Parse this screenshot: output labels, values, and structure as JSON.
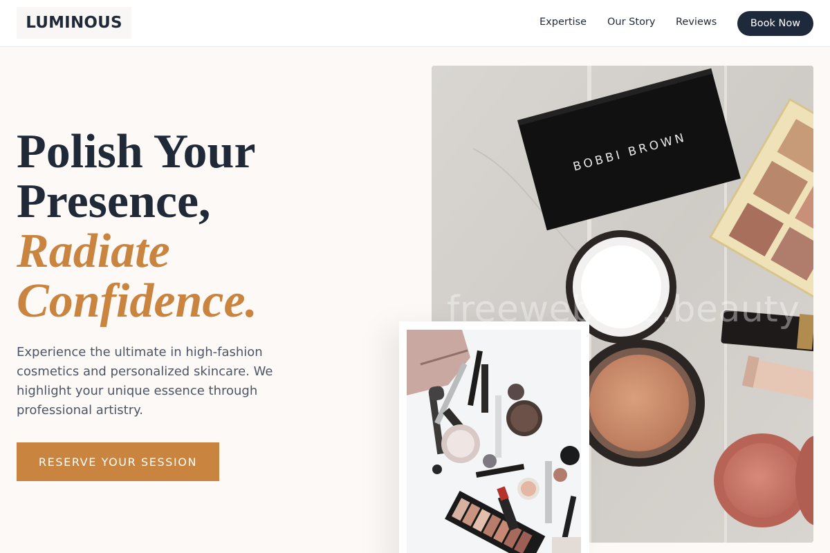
{
  "header": {
    "logo": "LUMINOUS",
    "nav": [
      {
        "label": "Expertise"
      },
      {
        "label": "Our Story"
      },
      {
        "label": "Reviews"
      }
    ],
    "cta_label": "Book Now"
  },
  "hero": {
    "headline_line1": "Polish Your",
    "headline_line2": "Presence,",
    "headline_accent_line1": "Radiate",
    "headline_accent_line2": "Confidence.",
    "description": "Experience the ultimate in high-fashion cosmetics and personalized skincare. We highlight your unique essence through professional artistry.",
    "cta_label": "RESERVE YOUR SESSION"
  },
  "images": {
    "main_brand_text": "BOBBI BROWN",
    "watermark": "freewebsite.beauty"
  },
  "colors": {
    "accent": "#c98540",
    "navy": "#1e293b",
    "background": "#fdf9f7"
  }
}
